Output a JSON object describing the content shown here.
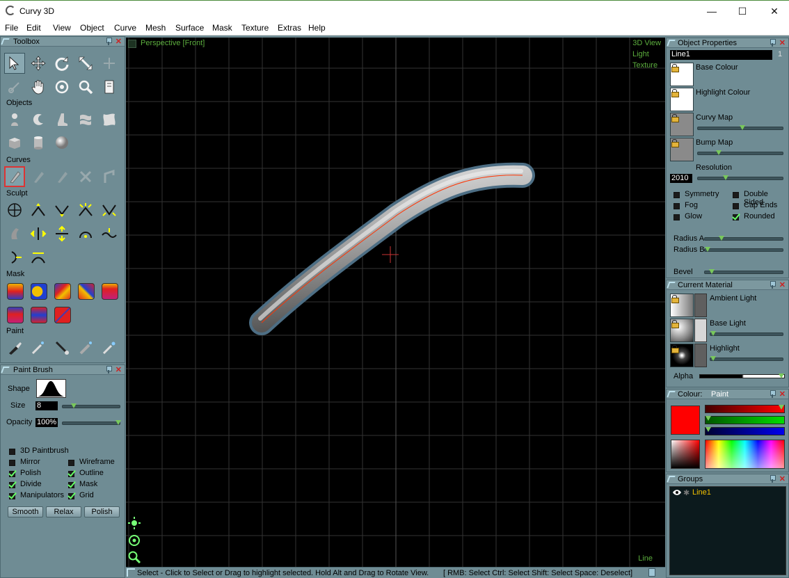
{
  "window": {
    "title": "Curvy 3D",
    "min": "—",
    "max": "☐",
    "close": "✕"
  },
  "menu": [
    "File",
    "Edit",
    "View",
    "Object",
    "Curve",
    "Mesh",
    "Surface",
    "Mask",
    "Texture",
    "Extras",
    "Help"
  ],
  "toolbox": {
    "title": "Toolbox",
    "sections": {
      "objects": "Objects",
      "curves": "Curves",
      "sculpt": "Sculpt",
      "mask": "Mask",
      "paint": "Paint"
    }
  },
  "paint_brush": {
    "title": "Paint Brush",
    "shape_label": "Shape",
    "size_label": "Size",
    "size_value": "8",
    "opacity_label": "Opacity",
    "opacity_value": "100%",
    "checks": [
      {
        "label": "3D Paintbrush",
        "checked": false
      },
      {
        "label": "Mirror",
        "checked": false
      },
      {
        "label": "Wireframe",
        "checked": false
      },
      {
        "label": "Polish",
        "checked": true
      },
      {
        "label": "Outline",
        "checked": true
      },
      {
        "label": "Divide",
        "checked": true
      },
      {
        "label": "Mask",
        "checked": true
      },
      {
        "label": "Manipulators",
        "checked": true
      },
      {
        "label": "Grid",
        "checked": true
      }
    ],
    "buttons": [
      "Smooth",
      "Relax",
      "Polish"
    ]
  },
  "viewport": {
    "view_name": "Perspective [Front]",
    "modes": [
      "3D View",
      "Light",
      "Texture"
    ],
    "bottom_right": "Line"
  },
  "status": {
    "message": "Select - Click to Select or Drag to highlight selected. Hold Alt and Drag to Rotate View.",
    "hints": "[ RMB: Select   Ctrl: Select   Shift: Select   Space: Deselect]"
  },
  "object_properties": {
    "title": "Object Properties",
    "name": "Line1",
    "count": "1",
    "base_colour": "Base Colour",
    "highlight_colour": "Highlight Colour",
    "curvy_map": "Curvy Map",
    "bump_map": "Bump Map",
    "resolution_label": "Resolution",
    "resolution_value": "2010",
    "checks": [
      {
        "label": "Symmetry",
        "checked": false
      },
      {
        "label": "Double Sided",
        "checked": false
      },
      {
        "label": "Fog",
        "checked": false
      },
      {
        "label": "Cap Ends",
        "checked": false
      },
      {
        "label": "Glow",
        "checked": false
      },
      {
        "label": "Rounded",
        "checked": true
      }
    ],
    "radius_a": "Radius A",
    "radius_b": "Radius B",
    "bevel": "Bevel"
  },
  "current_material": {
    "title": "Current Material",
    "ambient": "Ambient Light",
    "base": "Base Light",
    "highlight": "Highlight",
    "alpha": "Alpha"
  },
  "colour": {
    "title": "Colour:",
    "mode": "Paint",
    "current": "#ff0000"
  },
  "groups": {
    "title": "Groups",
    "items": [
      "Line1"
    ]
  }
}
